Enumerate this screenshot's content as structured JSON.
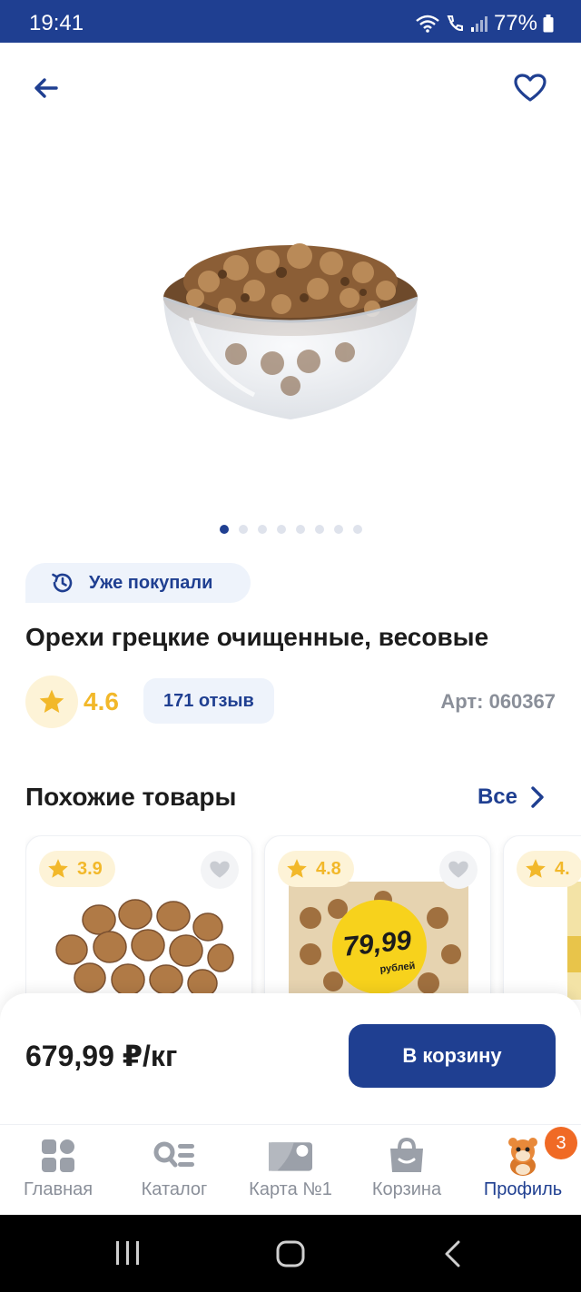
{
  "status_bar": {
    "time": "19:41",
    "battery": "77%"
  },
  "product": {
    "already_bought": "Уже покупали",
    "title": "Орехи грецкие очищенные, весовые",
    "rating": "4.6",
    "reviews": "171 отзыв",
    "article": "Арт: 060367",
    "image_count": 8,
    "active_image": 1
  },
  "similar": {
    "title": "Похожие товары",
    "all_label": "Все",
    "cards": [
      {
        "rating": "3.9"
      },
      {
        "rating": "4.8",
        "price_sticker": "79,99",
        "price_sticker_unit": "рублей"
      },
      {
        "rating": "4."
      }
    ]
  },
  "purchase": {
    "price": "679,99 ₽/кг",
    "cart_label": "В корзину"
  },
  "bottom_nav": {
    "items": [
      {
        "label": "Главная",
        "icon": "grid-icon"
      },
      {
        "label": "Каталог",
        "icon": "catalog-search-icon"
      },
      {
        "label": "Карта №1",
        "icon": "loyalty-card-icon"
      },
      {
        "label": "Корзина",
        "icon": "basket-icon"
      },
      {
        "label": "Профиль",
        "icon": "hamster-mascot-icon",
        "badge": "3"
      }
    ],
    "active_index": 4
  },
  "colors": {
    "primary": "#1f3f91",
    "star": "#f2b82a",
    "badge": "#f06a25",
    "muted": "#8a8f99"
  }
}
